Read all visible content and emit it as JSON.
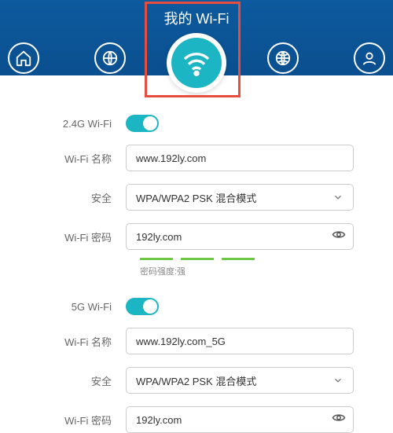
{
  "header": {
    "title": "我的 Wi-Fi"
  },
  "wifi24": {
    "toggle_label": "2.4G Wi-Fi",
    "name_label": "Wi-Fi 名称",
    "name_value": "www.192ly.com",
    "security_label": "安全",
    "security_value": "WPA/WPA2 PSK 混合模式",
    "password_label": "Wi-Fi 密码",
    "password_value": "192ly.com",
    "strength_text": "密码强度:强"
  },
  "wifi5": {
    "toggle_label": "5G Wi-Fi",
    "name_label": "Wi-Fi 名称",
    "name_value": "www.192ly.com_5G",
    "security_label": "安全",
    "security_value": "WPA/WPA2 PSK 混合模式",
    "password_label": "Wi-Fi 密码",
    "password_value": "192ly.com"
  }
}
